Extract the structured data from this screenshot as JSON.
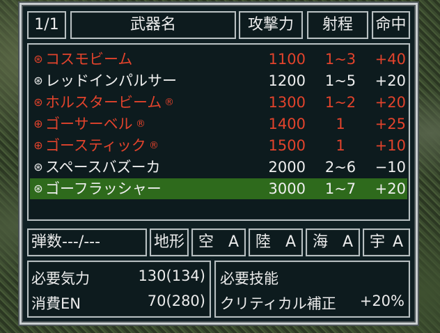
{
  "header": {
    "page": "1/1",
    "name_col": "武器名",
    "power_col": "攻撃力",
    "range_col": "射程",
    "accuracy_col": "命中"
  },
  "weapons": [
    {
      "icon": "⊛",
      "name": "コスモビーム",
      "tag": "",
      "power": "1100",
      "range": "1~3",
      "accuracy": "+40",
      "usable": false,
      "selected": false
    },
    {
      "icon": "⊛",
      "name": "レッドインパルサー",
      "tag": "",
      "power": "1200",
      "range": "1~5",
      "accuracy": "+20",
      "usable": true,
      "selected": false
    },
    {
      "icon": "⊛",
      "name": "ホルスタービーム",
      "tag": "®",
      "power": "1300",
      "range": "1~2",
      "accuracy": "+20",
      "usable": false,
      "selected": false
    },
    {
      "icon": "⊕",
      "name": "ゴーサーベル",
      "tag": "®",
      "power": "1400",
      "range": "1",
      "accuracy": "+25",
      "usable": false,
      "selected": false
    },
    {
      "icon": "⊕",
      "name": "ゴースティック",
      "tag": "®",
      "power": "1500",
      "range": "1",
      "accuracy": "+10",
      "usable": false,
      "selected": false
    },
    {
      "icon": "⊛",
      "name": "スペースバズーカ",
      "tag": "",
      "power": "2000",
      "range": "2~6",
      "accuracy": "−10",
      "usable": true,
      "selected": false
    },
    {
      "icon": "⊛",
      "name": "ゴーフラッシャー",
      "tag": "",
      "power": "3000",
      "range": "1~7",
      "accuracy": "+20",
      "usable": true,
      "selected": true
    }
  ],
  "ammo": "弾数---/---",
  "terrain_label": "地形",
  "terrain": [
    {
      "label": "空",
      "rank": "A"
    },
    {
      "label": "陸",
      "rank": "A"
    },
    {
      "label": "海",
      "rank": "A"
    },
    {
      "label": "宇",
      "rank": "A"
    }
  ],
  "requirements": {
    "morale_label": "必要気力",
    "morale_value": "130(134)",
    "en_label": "消費EN",
    "en_value": "70(280)",
    "skill_label": "必要技能",
    "critical_label": "クリティカル補正",
    "critical_value": "+20%"
  },
  "colors": {
    "usable_text": "#efefef",
    "unusable_text": "#e2432c",
    "selection": "#2e6a1c"
  }
}
